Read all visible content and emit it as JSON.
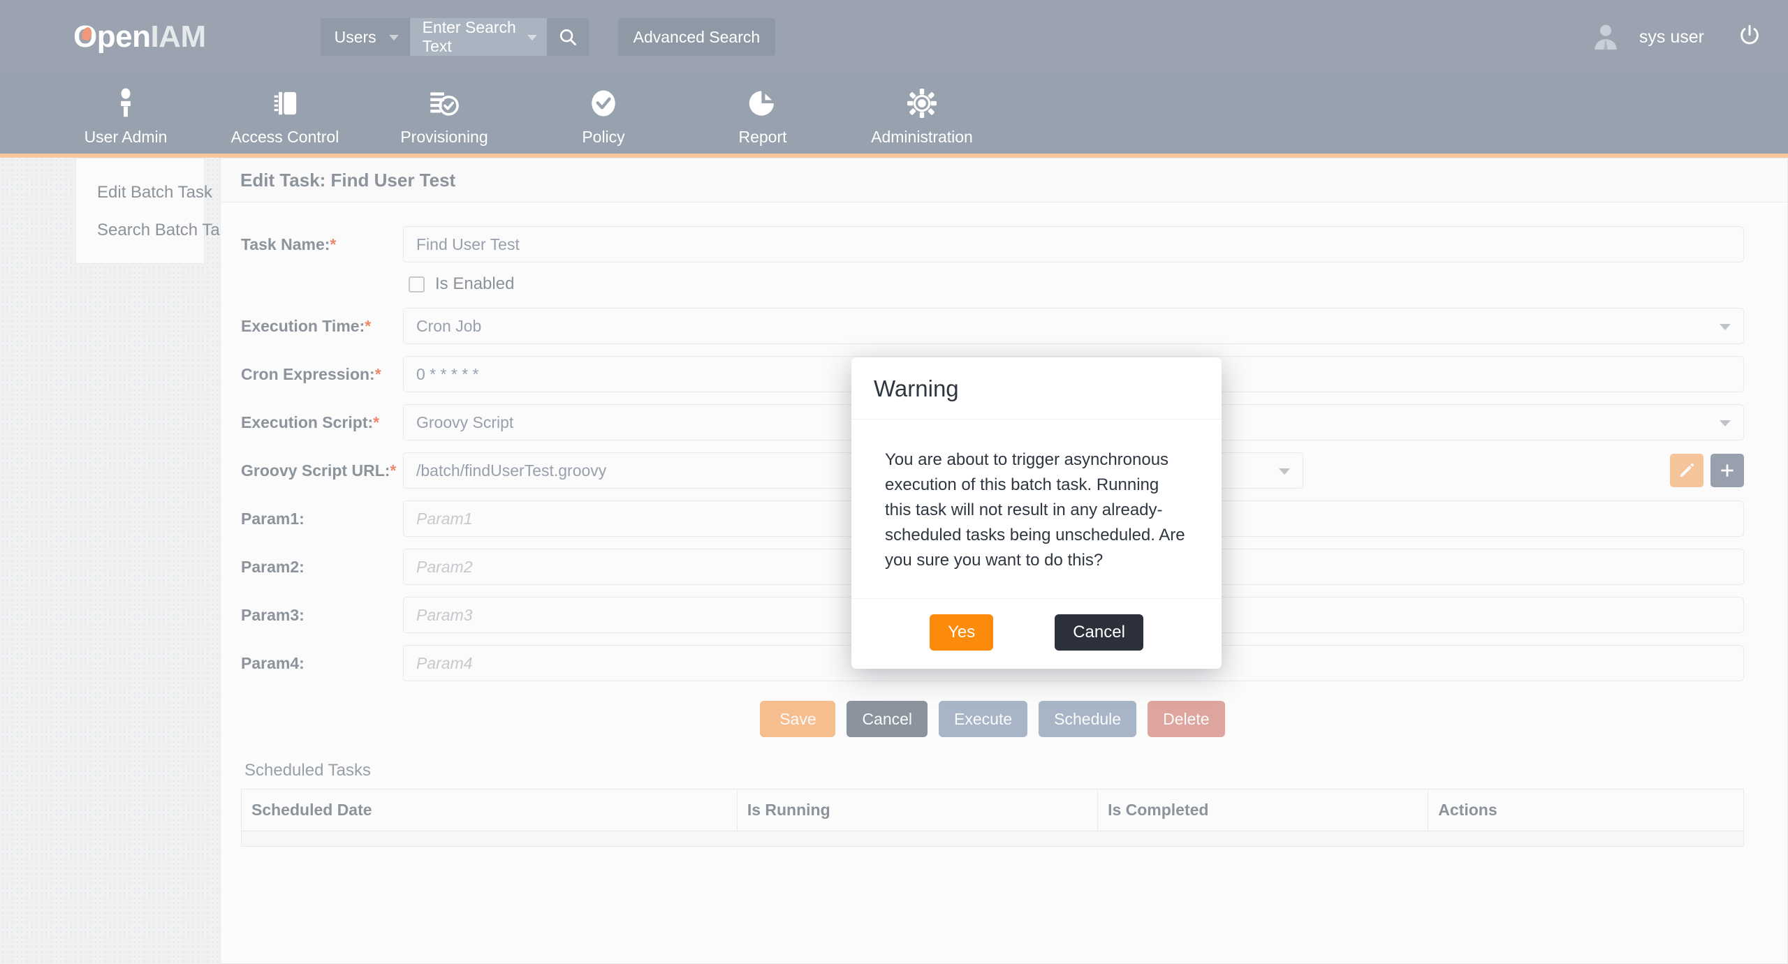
{
  "header": {
    "logo_open": "Open",
    "logo_iam": "IAM",
    "search_scope": "Users",
    "search_placeholder": "Enter Search Text",
    "search_icon": "search-icon",
    "advanced_search_label": "Advanced Search",
    "user_name": "sys user",
    "avatar_icon": "avatar-icon",
    "power_icon": "power-icon"
  },
  "nav": {
    "items": [
      {
        "label": "User Admin",
        "icon": "user-icon"
      },
      {
        "label": "Access Control",
        "icon": "door-badge-icon"
      },
      {
        "label": "Provisioning",
        "icon": "list-check-icon"
      },
      {
        "label": "Policy",
        "icon": "check-circle-icon"
      },
      {
        "label": "Report",
        "icon": "pie-chart-icon"
      },
      {
        "label": "Administration",
        "icon": "gear-icon"
      }
    ]
  },
  "sidebar": {
    "items": [
      {
        "label": "Edit Batch Task"
      },
      {
        "label": "Search Batch Tasks"
      }
    ]
  },
  "main": {
    "card_title": "Edit Task: Find User Test",
    "fields": {
      "task_name": {
        "label": "Task Name:",
        "required": "*",
        "value": "Find User Test"
      },
      "is_enabled": {
        "label": "Is Enabled",
        "checked": false
      },
      "execution_time": {
        "label": "Execution Time:",
        "required": "*",
        "value": "Cron Job"
      },
      "cron_expression": {
        "label": "Cron Expression:",
        "required": "*",
        "value": "0 * * * * *"
      },
      "execution_script": {
        "label": "Execution Script:",
        "required": "*",
        "value": "Groovy Script"
      },
      "groovy_script_url": {
        "label": "Groovy Script URL:",
        "required": "*",
        "value": "/batch/findUserTest.groovy",
        "edit_icon": "pencil-icon",
        "add_icon": "plus-icon"
      },
      "param1": {
        "label": "Param1:",
        "placeholder": "Param1",
        "value": ""
      },
      "param2": {
        "label": "Param2:",
        "placeholder": "Param2",
        "value": ""
      },
      "param3": {
        "label": "Param3:",
        "placeholder": "Param3",
        "value": ""
      },
      "param4": {
        "label": "Param4:",
        "placeholder": "Param4",
        "value": ""
      }
    },
    "actions": {
      "save": "Save",
      "cancel": "Cancel",
      "execute": "Execute",
      "schedule": "Schedule",
      "delete": "Delete"
    },
    "scheduled_tasks": {
      "title": "Scheduled Tasks",
      "columns": [
        "Scheduled Date",
        "Is Running",
        "Is Completed",
        "Actions"
      ],
      "rows": []
    }
  },
  "modal": {
    "title": "Warning",
    "message": "You are about to trigger asynchronous execution of this batch task. Running this task will not result in any already-scheduled tasks being unscheduled. Are you sure you want to do this?",
    "yes_label": "Yes",
    "cancel_label": "Cancel"
  },
  "colors": {
    "header_bg": "#9aa3af",
    "nav_bg": "#98a2ae",
    "accent_orange": "#f9c79c",
    "modal_yes": "#fd8b0b",
    "modal_cancel": "#2b303b",
    "required_star": "#f08a6c"
  }
}
